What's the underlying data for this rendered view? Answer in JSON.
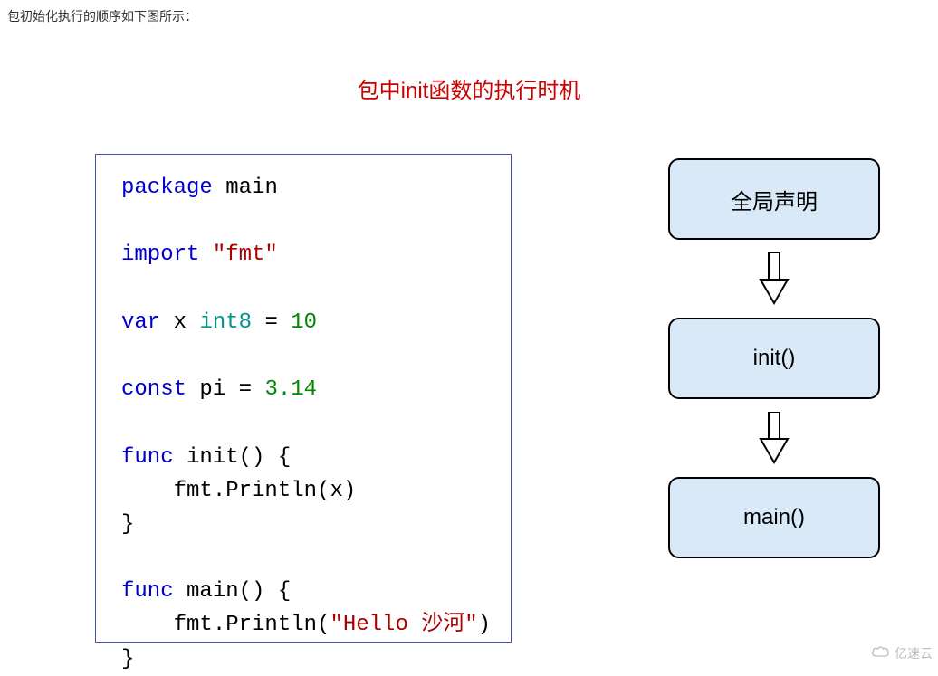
{
  "description": "包初始化执行的顺序如下图所示：",
  "diagram_title": "包中init函数的执行时机",
  "code": {
    "line1_kw": "package",
    "line1_name": " main",
    "line2_kw": "import",
    "line2_str": " \"fmt\"",
    "line3_kw": "var",
    "line3_rest1": " x ",
    "line3_type": "int8",
    "line3_rest2": " = ",
    "line3_num": "10",
    "line4_kw": "const",
    "line4_rest1": " pi = ",
    "line4_num": "3.14",
    "line5_kw": "func",
    "line5_rest": " init() {",
    "line6": "    fmt.Println(x)",
    "line7": "}",
    "line8_kw": "func",
    "line8_rest": " main() {",
    "line9_a": "    fmt.Println(",
    "line9_str": "\"Hello 沙河\"",
    "line9_b": ")",
    "line10": "}"
  },
  "flowchart": {
    "step1": "全局声明",
    "step2": "init()",
    "step3": "main()"
  },
  "watermark": "亿速云"
}
